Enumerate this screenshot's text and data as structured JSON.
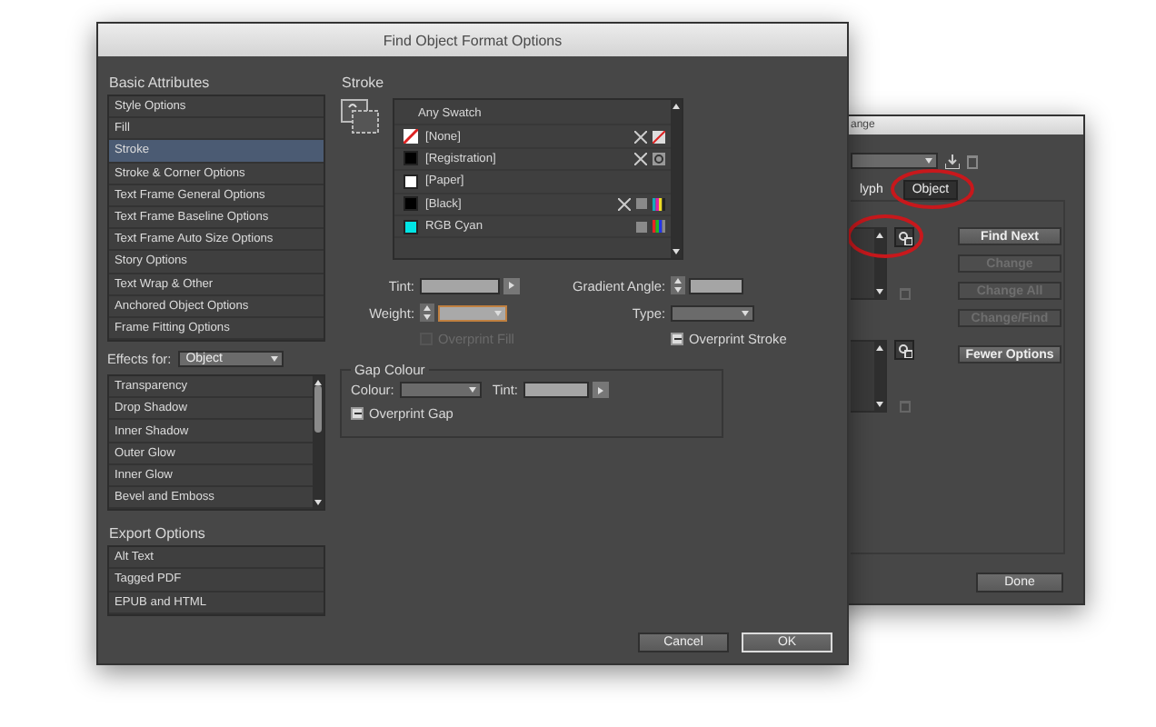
{
  "back_window": {
    "title": "ange",
    "tabs": [
      {
        "label": "lyph",
        "selected": false,
        "circled": false
      },
      {
        "label": "Object",
        "selected": true,
        "circled": true
      }
    ],
    "find_icon_circled": true,
    "buttons": [
      {
        "label": "Find Next",
        "disabled": false
      },
      {
        "label": "Change",
        "disabled": true
      },
      {
        "label": "Change All",
        "disabled": true
      },
      {
        "label": "Change/Find",
        "disabled": true
      },
      {
        "label": "Fewer Options",
        "disabled": false
      }
    ],
    "done": "Done"
  },
  "dialog": {
    "title": "Find Object Format Options",
    "basic_attributes": {
      "heading": "Basic Attributes",
      "items": [
        {
          "label": "Style Options",
          "selected": false
        },
        {
          "label": "Fill",
          "selected": false
        },
        {
          "label": "Stroke",
          "selected": true
        },
        {
          "label": "Stroke & Corner Options",
          "selected": false
        },
        {
          "label": "Text Frame General Options",
          "selected": false
        },
        {
          "label": "Text Frame Baseline Options",
          "selected": false
        },
        {
          "label": "Text Frame Auto Size Options",
          "selected": false
        },
        {
          "label": "Story Options",
          "selected": false
        },
        {
          "label": "Text Wrap & Other",
          "selected": false
        },
        {
          "label": "Anchored Object Options",
          "selected": false
        },
        {
          "label": "Frame Fitting Options",
          "selected": false
        }
      ]
    },
    "effects_for": {
      "label": "Effects for:",
      "value": "Object"
    },
    "effects": [
      "Transparency",
      "Drop Shadow",
      "Inner Shadow",
      "Outer Glow",
      "Inner Glow",
      "Bevel and Emboss"
    ],
    "export_options": {
      "heading": "Export Options",
      "items": [
        "Alt Text",
        "Tagged PDF",
        "EPUB and HTML"
      ]
    },
    "stroke": {
      "heading": "Stroke",
      "swatches": [
        {
          "name": "Any Swatch",
          "kind": "any"
        },
        {
          "name": "[None]",
          "kind": "none",
          "locked": true
        },
        {
          "name": "[Registration]",
          "kind": "registration",
          "color": "#000000",
          "locked": true
        },
        {
          "name": "[Paper]",
          "kind": "plain",
          "color": "#ffffff",
          "locked": false
        },
        {
          "name": "[Black]",
          "kind": "cmyk",
          "color": "#000000",
          "locked": true
        },
        {
          "name": "RGB Cyan",
          "kind": "rgb",
          "color": "#00e5e5",
          "locked": false
        }
      ],
      "tint": {
        "label": "Tint:"
      },
      "gradient_angle": {
        "label": "Gradient Angle:"
      },
      "weight": {
        "label": "Weight:"
      },
      "type": {
        "label": "Type:"
      },
      "overprint_fill": {
        "label": "Overprint Fill",
        "mixed": false,
        "disabled": true
      },
      "overprint_stroke": {
        "label": "Overprint Stroke",
        "mixed": true,
        "disabled": false
      }
    },
    "gap_colour": {
      "heading": "Gap Colour",
      "colour": {
        "label": "Colour:"
      },
      "tint": {
        "label": "Tint:"
      },
      "overprint_gap": {
        "label": "Overprint Gap",
        "mixed": true,
        "disabled": false
      }
    },
    "buttons": [
      {
        "label": "Cancel",
        "default": false
      },
      {
        "label": "OK",
        "default": true
      }
    ]
  }
}
